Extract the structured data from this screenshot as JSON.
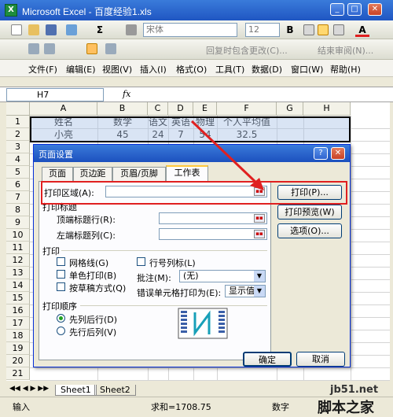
{
  "window": {
    "title": "Microsoft Excel - 百度经验1.xls"
  },
  "toolbar1": {
    "font_name": "宋体",
    "font_size": "12",
    "bold": "B",
    "underline_font": "A",
    "sigma": "Σ"
  },
  "toolbar2": {
    "reply_label": "回复时包含更改(C)...",
    "end_review_label": "结束审阅(N)..."
  },
  "menu": [
    "文件(F)",
    "编辑(E)",
    "视图(V)",
    "插入(I)",
    "格式(O)",
    "工具(T)",
    "数据(D)",
    "窗口(W)",
    "帮助(H)"
  ],
  "formula": {
    "name_box": "H7",
    "fx": "fx"
  },
  "columns": [
    "A",
    "B",
    "C",
    "D",
    "E",
    "F",
    "G",
    "H"
  ],
  "rows": [
    "1",
    "2",
    "3",
    "4",
    "5",
    "6",
    "7",
    "8",
    "9",
    "10",
    "11",
    "12",
    "13",
    "14",
    "15",
    "16",
    "17",
    "18",
    "19",
    "20",
    "21"
  ],
  "cells": {
    "r1": [
      "姓名",
      "数学",
      "语文",
      "英语",
      "物理",
      "个人平均值"
    ],
    "r2": [
      "小亮",
      "45",
      "24",
      "7",
      "54",
      "32.5"
    ]
  },
  "dialog": {
    "title": "页面设置",
    "tabs": [
      "页面",
      "页边距",
      "页眉/页脚",
      "工作表"
    ],
    "print_area_label": "打印区域(A):",
    "print_titles_label": "打印标题",
    "top_rows_label": "顶端标题行(R):",
    "left_cols_label": "左端标题列(C):",
    "print_group_label": "打印",
    "gridlines_label": "网格线(G)",
    "mono_label": "单色打印(B)",
    "draft_label": "按草稿方式(Q)",
    "row_col_headers_label": "行号列标(L)",
    "comments_label": "批注(M):",
    "comments_value": "(无)",
    "errors_label": "错误单元格打印为(E):",
    "errors_value": "显示值",
    "order_label": "打印顺序",
    "down_then_over": "先列后行(D)",
    "over_then_down": "先行后列(V)",
    "print_btn": "打印(P)...",
    "preview_btn": "打印预览(W)",
    "options_btn": "选项(O)...",
    "ok_btn": "确定",
    "cancel_btn": "取消"
  },
  "sheets": [
    "Sheet1",
    "Sheet2"
  ],
  "status": {
    "mode": "输入",
    "sum": "求和=1708.75",
    "num": "数字"
  },
  "watermark": {
    "site": "jb51.net",
    "brand": "脚本之家"
  }
}
